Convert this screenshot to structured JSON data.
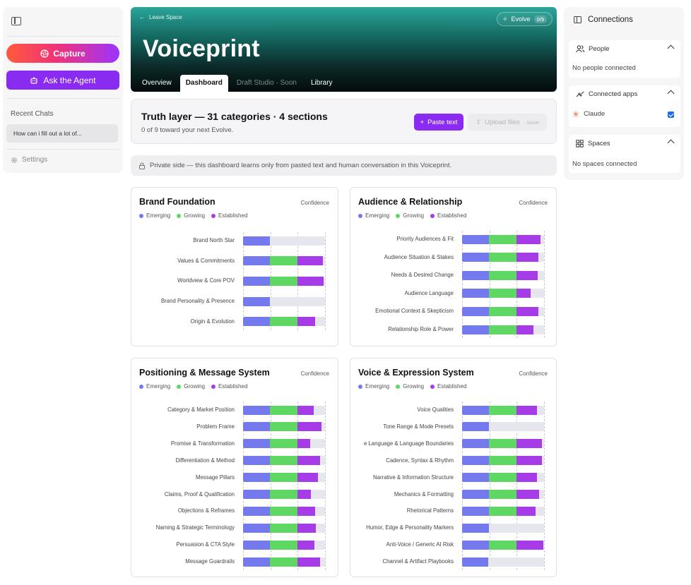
{
  "sidebar": {
    "capture_label": "Capture",
    "agent_label": "Ask the Agent",
    "recent_heading": "Recent Chats",
    "recent_chats": [
      "How can i fill out a lot of..."
    ],
    "settings_label": "Settings"
  },
  "header": {
    "back_label": "Leave Space",
    "evolve_label": "Evolve",
    "evolve_count": "0/9",
    "title": "Voiceprint",
    "tabs": [
      {
        "label": "Overview",
        "state": "normal"
      },
      {
        "label": "Dashboard",
        "state": "active"
      },
      {
        "label": "Draft Studio · Soon",
        "state": "muted"
      },
      {
        "label": "Library",
        "state": "normal"
      }
    ]
  },
  "truth": {
    "title": "Truth layer — 31 categories · 4 sections",
    "subtitle": "0 of 9 toward your next Evolve.",
    "paste_label": "Paste text",
    "upload_label": "Upload files",
    "upload_soon": "· Soon"
  },
  "notice": "Private side — this dashboard learns only from pasted text and human conversation in this Voiceprint.",
  "legend": {
    "emerging": "Emerging",
    "growing": "Growing",
    "established": "Established"
  },
  "confidence_label": "Confidence",
  "colors": {
    "emerging": "#7479ee",
    "growing": "#5fd863",
    "established": "#a63be8",
    "track": "#e6e7ee"
  },
  "chart_data": [
    {
      "type": "bar",
      "title": "Brand Foundation",
      "categories": [
        "Brand North Star",
        "Values & Commitments",
        "Worldview & Core POV",
        "Brand Personality & Presence",
        "Origin & Evolution"
      ],
      "series": [
        {
          "name": "Emerging",
          "values": [
            0.33,
            0.33,
            0.33,
            0.33,
            0.33
          ]
        },
        {
          "name": "Growing",
          "values": [
            0,
            0.33,
            0.33,
            0,
            0.33
          ]
        },
        {
          "name": "Established",
          "values": [
            0,
            0.31,
            0.32,
            0,
            0.22
          ]
        }
      ],
      "xlim": [
        0,
        1
      ]
    },
    {
      "type": "bar",
      "title": "Audience & Relationship",
      "categories": [
        "Priority Audiences & Fit",
        "Audience Situation & Stakes",
        "Needs & Desired Change",
        "Audience Language",
        "Emotional Context & Skepticism",
        "Relationship Role & Power"
      ],
      "series": [
        {
          "name": "Emerging",
          "values": [
            0.33,
            0.33,
            0.33,
            0.33,
            0.33,
            0.33
          ]
        },
        {
          "name": "Growing",
          "values": [
            0.33,
            0.33,
            0.33,
            0.33,
            0.33,
            0.33
          ]
        },
        {
          "name": "Established",
          "values": [
            0.3,
            0.27,
            0.26,
            0.18,
            0.27,
            0.21
          ]
        }
      ],
      "xlim": [
        0,
        1
      ]
    },
    {
      "type": "bar",
      "title": "Positioning & Message System",
      "categories": [
        "Category & Market Position",
        "Problem Frame",
        "Promise & Transformation",
        "Differentiation & Method",
        "Message Pillars",
        "Claims, Proof & Qualification",
        "Objections & Reframes",
        "Naming & Strategic Terminology",
        "Persuasion & CTA Style",
        "Message Guardrails"
      ],
      "series": [
        {
          "name": "Emerging",
          "values": [
            0.33,
            0.33,
            0.33,
            0.33,
            0.33,
            0.33,
            0.33,
            0.33,
            0.33,
            0.33
          ]
        },
        {
          "name": "Growing",
          "values": [
            0.33,
            0.33,
            0.33,
            0.33,
            0.33,
            0.33,
            0.33,
            0.33,
            0.33,
            0.33
          ]
        },
        {
          "name": "Established",
          "values": [
            0.2,
            0.3,
            0.16,
            0.28,
            0.25,
            0.17,
            0.22,
            0.23,
            0.21,
            0.28
          ]
        }
      ],
      "xlim": [
        0,
        1
      ]
    },
    {
      "type": "bar",
      "title": "Voice & Expression System",
      "categories": [
        "Voice Qualities",
        "Tone Range & Mode Presets",
        "e Language & Language Boundaries",
        "Cadence, Syntax & Rhythm",
        "Narrative & Information Structure",
        "Mechanics & Formatting",
        "Rhetorical Patterns",
        "Humor, Edge & Personality Markers",
        "Anti-Voice / Generic AI Risk",
        "Channel & Artifact Playbooks"
      ],
      "series": [
        {
          "name": "Emerging",
          "values": [
            0.33,
            0.33,
            0.33,
            0.33,
            0.33,
            0.33,
            0.33,
            0.33,
            0.33,
            0.32
          ]
        },
        {
          "name": "Growing",
          "values": [
            0.33,
            0,
            0.33,
            0.33,
            0.33,
            0.33,
            0.33,
            0,
            0.33,
            0
          ]
        },
        {
          "name": "Established",
          "values": [
            0.25,
            0,
            0.31,
            0.31,
            0.25,
            0.28,
            0.24,
            0,
            0.33,
            0
          ]
        }
      ],
      "xlim": [
        0,
        1
      ]
    }
  ],
  "right": {
    "title": "Connections",
    "people": {
      "label": "People",
      "empty": "No people connected"
    },
    "apps": {
      "label": "Connected apps",
      "items": [
        {
          "name": "Claude",
          "checked": true
        }
      ]
    },
    "spaces": {
      "label": "Spaces",
      "empty": "No spaces connected"
    }
  }
}
